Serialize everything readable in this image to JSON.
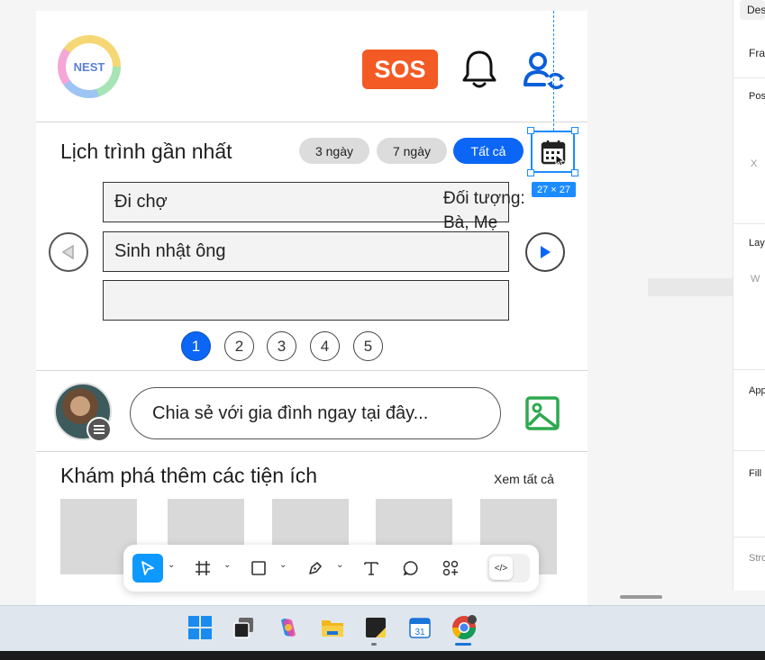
{
  "header": {
    "logo_text": "NEST",
    "sos_label": "SOS",
    "icons": [
      "bell-icon",
      "user-sync-icon"
    ],
    "colors": {
      "sos": "#f35a24",
      "accent": "#0b66f5"
    }
  },
  "schedule": {
    "title": "Lịch trình gần nhất",
    "filters": [
      "3 ngày",
      "7 ngày",
      "Tất cả"
    ],
    "active_filter": "Tất cả",
    "items": [
      "Đi chợ",
      "Sinh nhật ông",
      ""
    ],
    "target_line1": "Đối tượng:",
    "target_line2": "Bà, Mẹ",
    "pages": [
      "1",
      "2",
      "3",
      "4",
      "5"
    ],
    "active_page": "1",
    "selection_size": "27 × 27"
  },
  "share": {
    "placeholder": "Chia sẻ với gia đình ngay tại đây..."
  },
  "explore": {
    "title": "Khám phá thêm các tiện ích",
    "see_all": "Xem tất cả"
  },
  "toolbar": {
    "tools": [
      "move-tool",
      "frame-tool",
      "shape-tool",
      "pen-tool",
      "text-tool",
      "comment-tool",
      "actions-tool",
      "dev-mode-toggle"
    ],
    "active": "move-tool"
  },
  "right_panel": {
    "tab": "Des",
    "sections": [
      "Fra",
      "Pos",
      "X",
      "Lay",
      "W",
      "App",
      "Fill",
      "Stro"
    ]
  },
  "taskbar": {
    "apps": [
      "windows-start",
      "task-view",
      "copilot",
      "file-explorer",
      "sticky-notes",
      "calendar",
      "chrome"
    ],
    "calendar_badge": "31"
  }
}
